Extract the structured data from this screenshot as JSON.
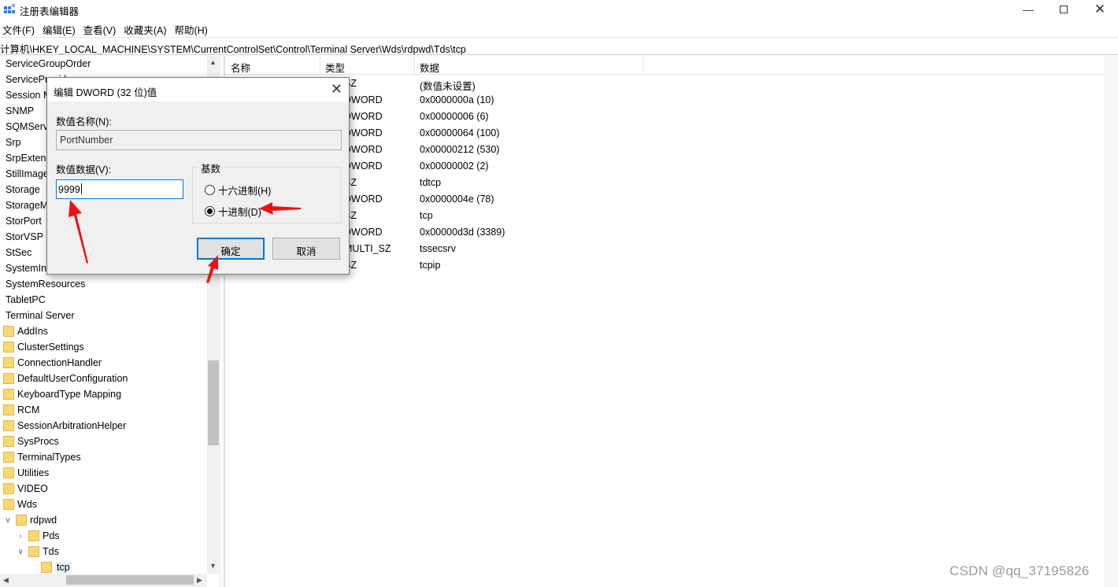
{
  "window": {
    "title": "注册表编辑器"
  },
  "menu": [
    "文件(F)",
    "编辑(E)",
    "查看(V)",
    "收藏夹(A)",
    "帮助(H)"
  ],
  "address": "计算机\\HKEY_LOCAL_MACHINE\\SYSTEM\\CurrentControlSet\\Control\\Terminal Server\\Wds\\rdpwd\\Tds\\tcp",
  "tree": {
    "items": [
      "ServiceGroupOrder",
      "ServiceProvider",
      "Session Manager",
      "SNMP",
      "SQMServiceList",
      "Srp",
      "SrpExtensionConfig",
      "StillImage",
      "Storage",
      "StorageManagement",
      "StorPort",
      "StorVSP",
      "StSec",
      "SystemInformation",
      "SystemResources",
      "TabletPC",
      "Terminal Server",
      "AddIns",
      "ClusterSettings",
      "ConnectionHandler",
      "DefaultUserConfiguration",
      "KeyboardType Mapping",
      "RCM",
      "SessionArbitrationHelper",
      "SysProcs",
      "TerminalTypes",
      "Utilities",
      "VIDEO",
      "Wds",
      "rdpwd",
      "Pds",
      "Tds",
      "tcp"
    ]
  },
  "list": {
    "headers": {
      "name": "名称",
      "type": "类型",
      "data": "数据"
    },
    "rows": [
      {
        "type": "SZ",
        "data": "(数值未设置)"
      },
      {
        "type": "DWORD",
        "data": "0x0000000a (10)"
      },
      {
        "type": "DWORD",
        "data": "0x00000006 (6)"
      },
      {
        "type": "DWORD",
        "data": "0x00000064 (100)"
      },
      {
        "type": "DWORD",
        "data": "0x00000212 (530)"
      },
      {
        "type": "DWORD",
        "data": "0x00000002 (2)"
      },
      {
        "type": "SZ",
        "data": "tdtcp"
      },
      {
        "type": "DWORD",
        "data": "0x0000004e (78)"
      },
      {
        "type": "SZ",
        "data": "tcp"
      },
      {
        "type": "DWORD",
        "data": "0x00000d3d (3389)"
      },
      {
        "type": "MULTI_SZ",
        "data": "tssecsrv"
      },
      {
        "type": "SZ",
        "data": "tcpip"
      }
    ]
  },
  "dialog": {
    "title": "编辑 DWORD (32 位)值",
    "name_label": "数值名称(N):",
    "name_value": "PortNumber",
    "data_label": "数值数据(V):",
    "data_value": "9999",
    "base_label": "基数",
    "hex_label": "十六进制(H)",
    "dec_label": "十进制(D)",
    "selected_base": "十进制(D)",
    "ok_label": "确定",
    "cancel_label": "取消"
  },
  "watermark": "CSDN @qq_37195826",
  "colors": {
    "accent": "#0078d7",
    "folder": "#f8d775",
    "annotation_arrow": "#ee1111"
  }
}
